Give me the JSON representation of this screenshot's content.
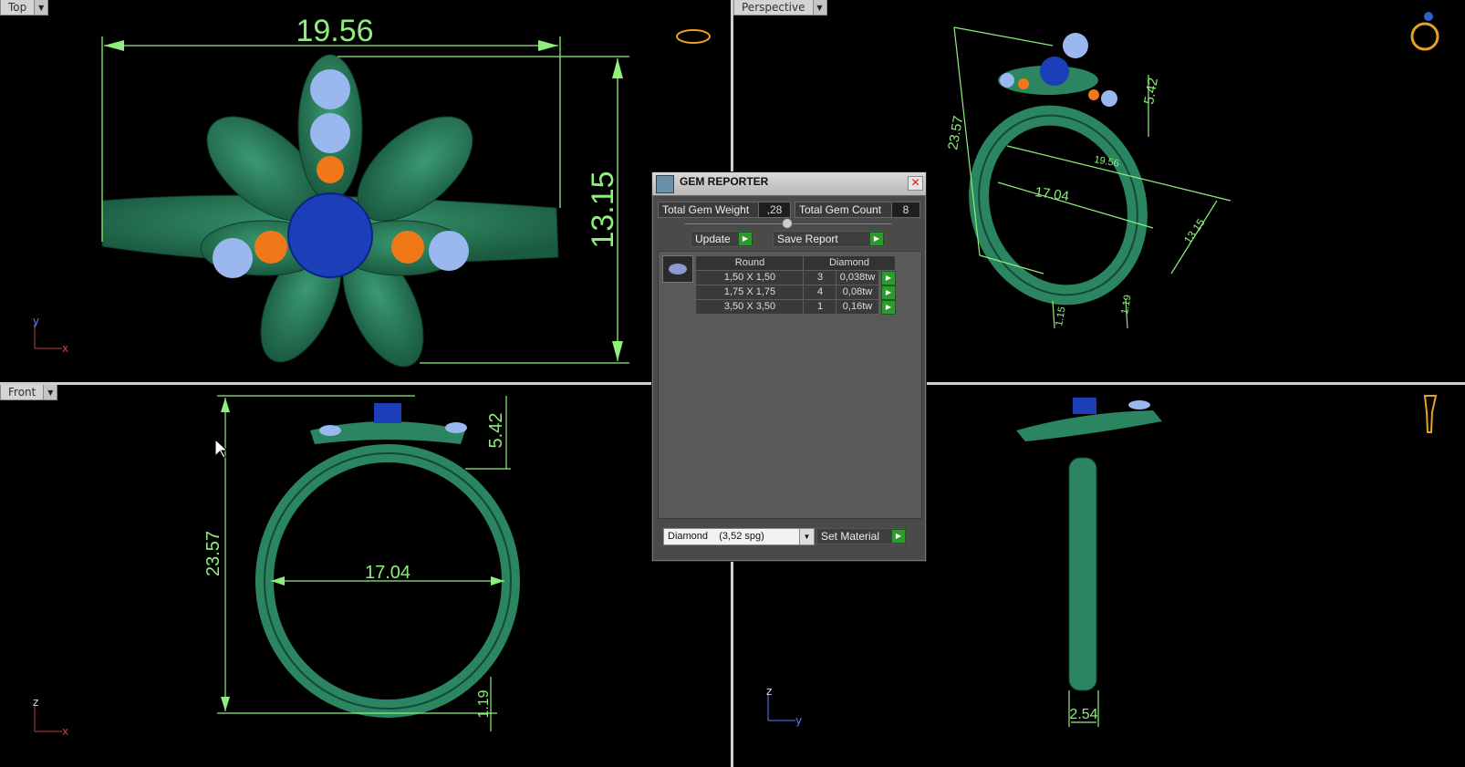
{
  "viewports": {
    "top": {
      "label": "Top",
      "dims": {
        "width": "19.56",
        "height": "13.15"
      },
      "axes": {
        "v": "y",
        "h": "x"
      }
    },
    "perspective": {
      "label": "Perspective",
      "dims": {
        "height": "23.57",
        "diameter": "17.04",
        "top": "5.42",
        "width": "19.56",
        "depth": "13.15",
        "band": "1.19",
        "band2": "1.15"
      }
    },
    "front": {
      "label": "Front",
      "dims": {
        "height": "23.57",
        "diameter": "17.04",
        "top": "5.42",
        "band": "1.19"
      },
      "axes": {
        "v": "z",
        "h": "x"
      }
    },
    "right": {
      "dims": {
        "width": "2.54"
      },
      "axes": {
        "v": "z",
        "h": "y"
      }
    }
  },
  "gem_reporter": {
    "title": "GEM REPORTER",
    "total_weight_label": "Total Gem Weight",
    "total_weight_value": ",28",
    "total_count_label": "Total Gem Count",
    "total_count_value": "8",
    "update_label": "Update",
    "save_label": "Save Report",
    "columns": [
      "Round",
      "Diamond"
    ],
    "rows": [
      {
        "size": "1,50 X 1,50",
        "count": "3",
        "weight": "0,038tw"
      },
      {
        "size": "1,75 X 1,75",
        "count": "4",
        "weight": "0,08tw"
      },
      {
        "size": "3,50 X 3,50",
        "count": "1",
        "weight": "0,16tw"
      }
    ],
    "material_selected": "Diamond    (3,52 spg)",
    "set_material_label": "Set Material"
  },
  "colors": {
    "ring": "#1f6e4f",
    "dimension": "#8fef7c",
    "center_stone": "#1b3fb8",
    "side_stone": "#9ab8ef",
    "accent_stone": "#f07818"
  }
}
